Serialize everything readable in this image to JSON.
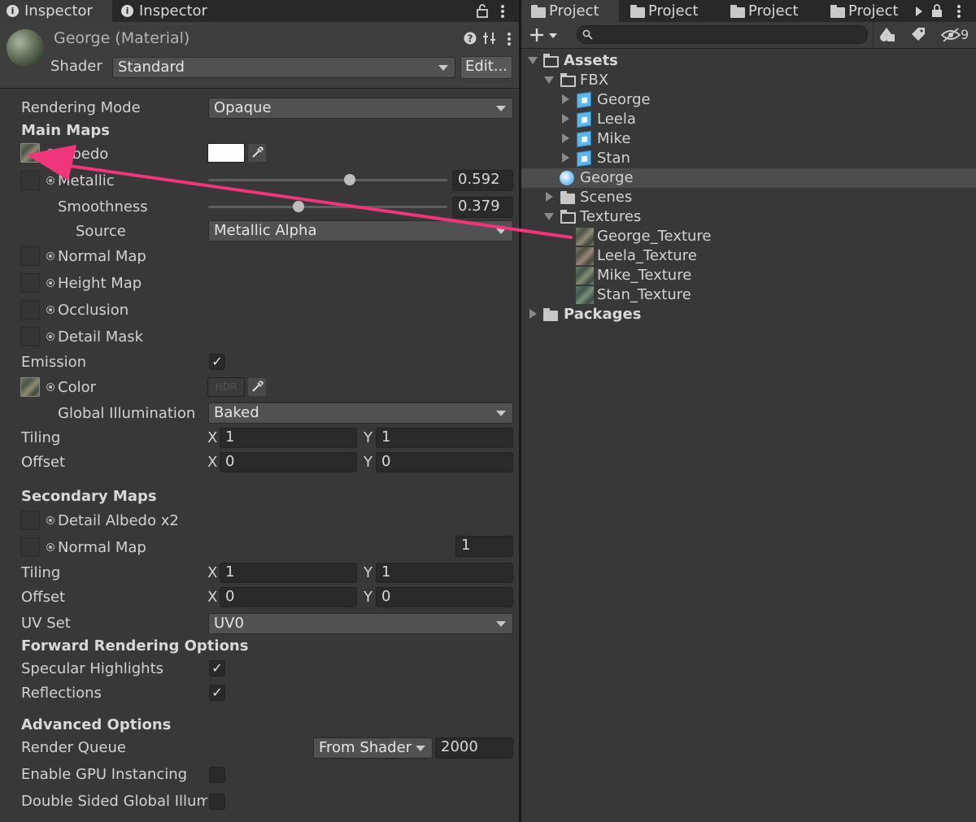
{
  "inspector": {
    "tabs": [
      {
        "label": "Inspector"
      },
      {
        "label": "Inspector"
      }
    ],
    "title": "George (Material)",
    "shader_label": "Shader",
    "shader_value": "Standard",
    "edit_button": "Edit...",
    "rendering_mode_label": "Rendering Mode",
    "rendering_mode_value": "Opaque",
    "main_maps": "Main Maps",
    "albedo": "Albedo",
    "metallic": "Metallic",
    "metallic_value": "0.592",
    "smoothness": "Smoothness",
    "smoothness_value": "0.379",
    "source": "Source",
    "source_value": "Metallic Alpha",
    "normal_map": "Normal Map",
    "height_map": "Height Map",
    "occlusion": "Occlusion",
    "detail_mask": "Detail Mask",
    "emission": "Emission",
    "color": "Color",
    "hdr": "HDR",
    "global_illumination": "Global Illumination",
    "gi_value": "Baked",
    "tiling": "Tiling",
    "offset": "Offset",
    "x": "X",
    "y": "Y",
    "main_tiling_x": "1",
    "main_tiling_y": "1",
    "main_offset_x": "0",
    "main_offset_y": "0",
    "secondary_maps": "Secondary Maps",
    "detail_albedo": "Detail Albedo x2",
    "normal_map2": "Normal Map",
    "normal_map2_value": "1",
    "sec_tiling_x": "1",
    "sec_tiling_y": "1",
    "sec_offset_x": "0",
    "sec_offset_y": "0",
    "uv_set": "UV Set",
    "uv_set_value": "UV0",
    "forward_rendering": "Forward Rendering Options",
    "specular": "Specular Highlights",
    "reflections": "Reflections",
    "advanced": "Advanced Options",
    "render_queue": "Render Queue",
    "render_queue_mode": "From Shader",
    "render_queue_value": "2000",
    "gpu_instancing": "Enable GPU Instancing",
    "double_sided": "Double Sided Global Illumin",
    "metallic_level": 0.592,
    "smoothness_level": 0.379
  },
  "project": {
    "tabs": [
      {
        "label": "Project"
      },
      {
        "label": "Project"
      },
      {
        "label": "Project"
      },
      {
        "label": "Project"
      }
    ],
    "badge": "9",
    "tree": {
      "assets": "Assets",
      "fbx": "FBX",
      "george": "George",
      "leela": "Leela",
      "mike": "Mike",
      "stan": "Stan",
      "george_mat": "George",
      "scenes": "Scenes",
      "textures": "Textures",
      "george_tex": "George_Texture",
      "leela_tex": "Leela_Texture",
      "mike_tex": "Mike_Texture",
      "stan_tex": "Stan_Texture",
      "packages": "Packages"
    }
  },
  "colors": {
    "arrow": "#f0367a",
    "selection": "#4d4d4d",
    "accent_blue": "#5cb8ec"
  }
}
